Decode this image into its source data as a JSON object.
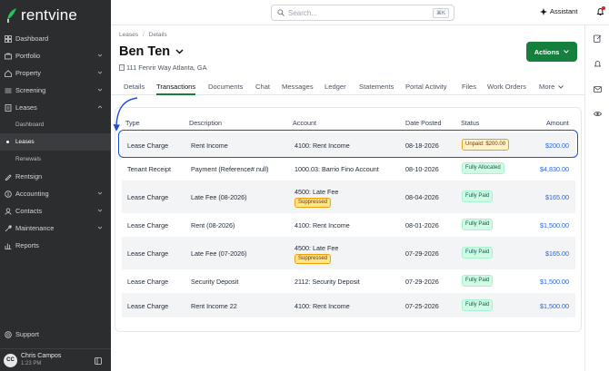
{
  "app": {
    "logo_text": "rentvine"
  },
  "sidebar": {
    "items": [
      {
        "label": "Dashboard",
        "icon": "dashboard-icon",
        "has_chevron": false
      },
      {
        "label": "Portfolio",
        "icon": "portfolio-icon",
        "has_chevron": true
      },
      {
        "label": "Property",
        "icon": "property-icon",
        "has_chevron": true
      },
      {
        "label": "Screening",
        "icon": "screening-icon",
        "has_chevron": true
      },
      {
        "label": "Leases",
        "icon": "leases-icon",
        "has_chevron": true,
        "expanded": true
      }
    ],
    "sub_items": [
      {
        "label": "Dashboard",
        "active": false
      },
      {
        "label": "Leases",
        "active": true
      },
      {
        "label": "Renewals",
        "active": false
      }
    ],
    "items_after": [
      {
        "label": "Rentsign",
        "icon": "rentsign-icon",
        "has_chevron": false
      },
      {
        "label": "Accounting",
        "icon": "accounting-icon",
        "has_chevron": true
      },
      {
        "label": "Contacts",
        "icon": "contacts-icon",
        "has_chevron": true
      },
      {
        "label": "Maintenance",
        "icon": "maintenance-icon",
        "has_chevron": true
      },
      {
        "label": "Reports",
        "icon": "reports-icon",
        "has_chevron": false
      }
    ],
    "support_label": "Support",
    "user": {
      "initials": "CC",
      "name": "Chris Campos",
      "time": "1:23 PM"
    }
  },
  "topbar": {
    "search_placeholder": "Search...",
    "search_shortcut": "⌘K",
    "assistant_label": "Assistant"
  },
  "page": {
    "breadcrumb": [
      "Leases",
      "Details"
    ],
    "title": "Ben Ten",
    "address": "111 Fenrir Way Atlanta, GA",
    "actions_label": "Actions"
  },
  "tabs": [
    {
      "label": "Details",
      "active": false
    },
    {
      "label": "Transactions",
      "active": true
    },
    {
      "label": "Documents",
      "active": false
    },
    {
      "label": "Chat",
      "active": false
    },
    {
      "label": "Messages",
      "active": false
    },
    {
      "label": "Ledger",
      "active": false
    },
    {
      "label": "Statements",
      "active": false
    },
    {
      "label": "Portal Activity",
      "active": false
    },
    {
      "label": "Files",
      "active": false
    },
    {
      "label": "Work Orders",
      "active": false
    },
    {
      "label": "More",
      "active": false
    }
  ],
  "table": {
    "headers": [
      "Type",
      "Description",
      "Account",
      "Date Posted",
      "Status",
      "Amount"
    ],
    "rows": [
      {
        "type": "Lease Charge",
        "description": "Rent Income",
        "account": "4100: Rent Income",
        "account_badge": "",
        "date": "08-18-2026",
        "status": "Unpaid: $200.00",
        "status_kind": "unpaid",
        "amount": "$200.00"
      },
      {
        "type": "Tenant Receipt",
        "description": "Payment (Reference# null)",
        "account": "1000.03: Barrio Fino Account",
        "account_badge": "",
        "date": "08-10-2026",
        "status": "Fully Allocated",
        "status_kind": "paid",
        "amount": "$4,830.00"
      },
      {
        "type": "Lease Charge",
        "description": "Late Fee (08-2026)",
        "account": "4500: Late Fee",
        "account_badge": "Suppressed",
        "date": "08-04-2026",
        "status": "Fully Paid",
        "status_kind": "paid",
        "amount": "$165.00"
      },
      {
        "type": "Lease Charge",
        "description": "Rent (08-2026)",
        "account": "4100: Rent Income",
        "account_badge": "",
        "date": "08-01-2026",
        "status": "Fully Paid",
        "status_kind": "paid",
        "amount": "$1,500.00"
      },
      {
        "type": "Lease Charge",
        "description": "Late Fee (07-2026)",
        "account": "4500: Late Fee",
        "account_badge": "Suppressed",
        "date": "07-29-2026",
        "status": "Fully Paid",
        "status_kind": "paid",
        "amount": "$165.00"
      },
      {
        "type": "Lease Charge",
        "description": "Security Deposit",
        "account": "2112: Security Deposit",
        "account_badge": "",
        "date": "07-29-2026",
        "status": "Fully Paid",
        "status_kind": "paid",
        "amount": "$1,500.00"
      },
      {
        "type": "Lease Charge",
        "description": "Rent Income 22",
        "account": "4100: Rent Income",
        "account_badge": "",
        "date": "07-25-2026",
        "status": "Fully Paid",
        "status_kind": "paid",
        "amount": "$1,500.00"
      }
    ]
  },
  "colors": {
    "brand_green": "#15803d",
    "link_blue": "#2563eb",
    "highlight_blue": "#1d4ed8",
    "sidebar_bg": "#2b2d2f"
  }
}
